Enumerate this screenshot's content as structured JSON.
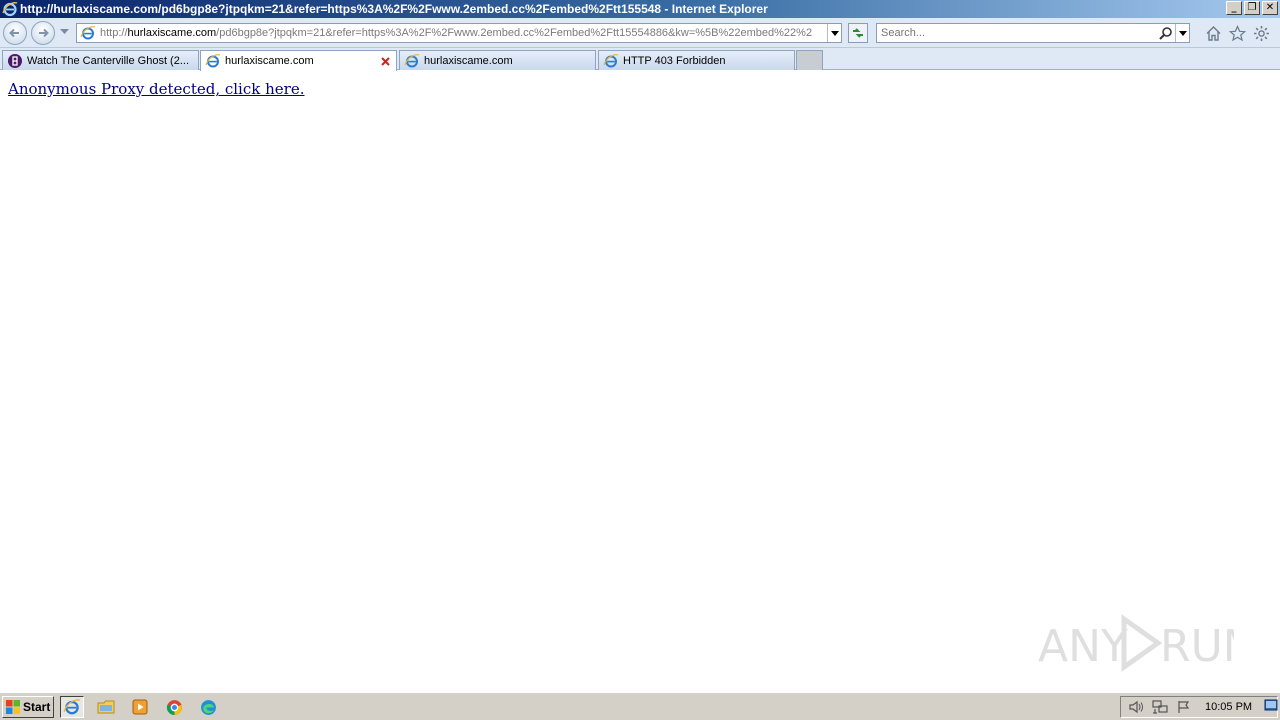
{
  "window": {
    "title": "http://hurlaxiscame.com/pd6bgp8e?jtpqkm=21&refer=https%3A%2F%2Fwww.2embed.cc%2Fembed%2Ftt155548 - Internet Explorer",
    "minimize_glyph": "_",
    "restore_glyph": "❐",
    "close_glyph": "✕"
  },
  "navbar": {
    "address_prefix": "http://",
    "address_domain": "hurlaxiscame.com",
    "address_rest": "/pd6bgp8e?jtpqkm=21&refer=https%3A%2F%2Fwww.2embed.cc%2Fembed%2Ftt15554886&kw=%5B%22embed%22%2",
    "search_placeholder": "Search..."
  },
  "tabs": [
    {
      "label": "Watch The Canterville Ghost (2...",
      "icon": "site-favicon-icon",
      "active": false
    },
    {
      "label": "hurlaxiscame.com",
      "icon": "ie-page-icon",
      "active": true
    },
    {
      "label": "hurlaxiscame.com",
      "icon": "ie-page-icon",
      "active": false
    },
    {
      "label": "HTTP 403 Forbidden",
      "icon": "ie-page-icon",
      "active": false
    }
  ],
  "content": {
    "proxy_link": "Anonymous Proxy detected, click here."
  },
  "watermark": {
    "text_left": "ANY",
    "text_right": "RUN"
  },
  "taskbar": {
    "start_label": "Start",
    "clock": "10:05 PM"
  },
  "colors": {
    "titlebar_start": "#0a246a",
    "link": "#000080",
    "tab_close": "#d02020"
  }
}
